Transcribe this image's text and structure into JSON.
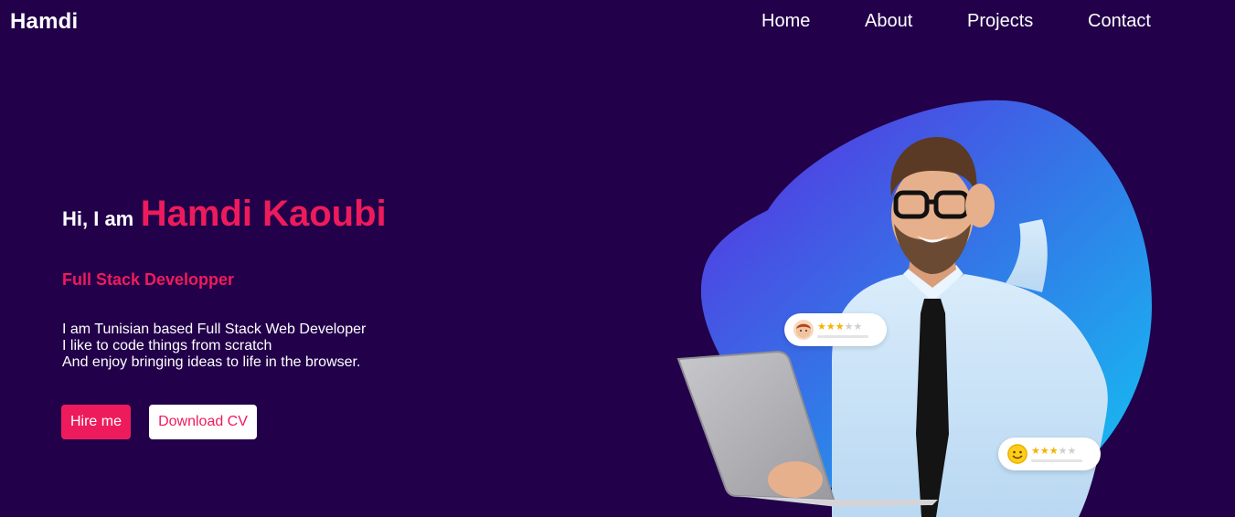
{
  "header": {
    "logo": "Hamdi",
    "nav": [
      {
        "label": "Home"
      },
      {
        "label": "About"
      },
      {
        "label": "Projects"
      },
      {
        "label": "Contact"
      }
    ]
  },
  "hero": {
    "greeting": "Hi, I am",
    "name": "Hamdi Kaoubi",
    "role": "Full Stack Developper",
    "bio": [
      "I am Tunisian based Full Stack Web Developer",
      "I like to code things from scratch",
      "And enjoy bringing ideas to life in the browser."
    ],
    "buttons": {
      "hire": "Hire me",
      "cv": "Download CV"
    }
  },
  "illustration": {
    "review_cards": [
      {
        "avatar_icon": "boy-avatar-icon",
        "rating": 3,
        "max_rating": 5
      },
      {
        "avatar_icon": "smiley-avatar-icon",
        "rating": 3,
        "max_rating": 5
      }
    ]
  },
  "colors": {
    "background": "#22004a",
    "accent": "#ee1b5c",
    "blob_gradient_start": "#5b2be0",
    "blob_gradient_end": "#12c6f3"
  }
}
